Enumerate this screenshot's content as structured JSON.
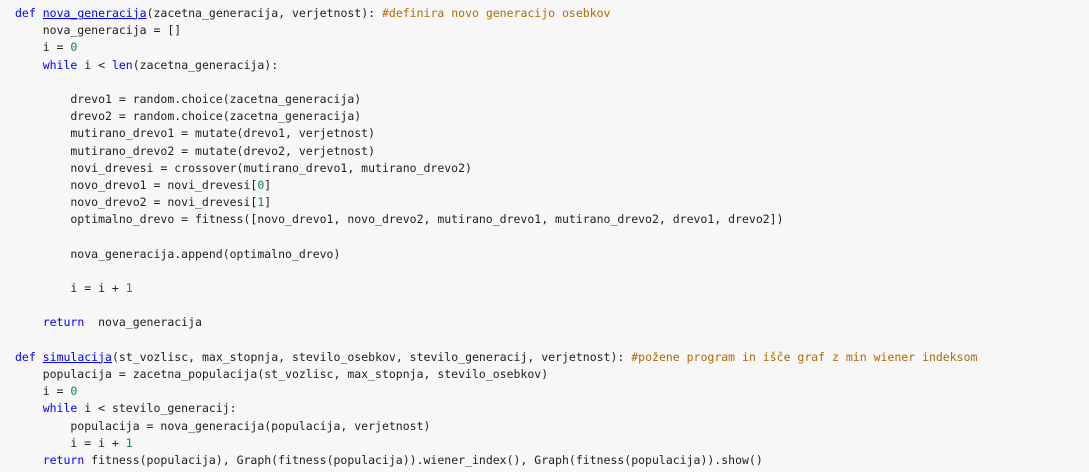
{
  "editor": {
    "background": "#f7f7f7",
    "colors": {
      "keyword": "#0000ff",
      "number": "#098658",
      "comment": "#af6b00",
      "text": "#212121"
    },
    "lines": [
      [
        {
          "t": "def",
          "c": "kw"
        },
        {
          "t": " ",
          "c": "pl"
        },
        {
          "t": "nova_generacija",
          "c": "fn"
        },
        {
          "t": "(zacetna_generacija, verjetnost): ",
          "c": "pl"
        },
        {
          "t": "#definira novo generacijo osebkov",
          "c": "cm"
        }
      ],
      [
        {
          "t": "    nova_generacija = []",
          "c": "pl"
        }
      ],
      [
        {
          "t": "    i = ",
          "c": "pl"
        },
        {
          "t": "0",
          "c": "num"
        }
      ],
      [
        {
          "t": "    ",
          "c": "pl"
        },
        {
          "t": "while",
          "c": "kw"
        },
        {
          "t": " i < ",
          "c": "pl"
        },
        {
          "t": "len",
          "c": "kw2"
        },
        {
          "t": "(zacetna_generacija):",
          "c": "pl"
        }
      ],
      [
        {
          "t": "",
          "c": "pl"
        }
      ],
      [
        {
          "t": "        drevo1 = random.choice(zacetna_generacija)",
          "c": "pl"
        }
      ],
      [
        {
          "t": "        drevo2 = random.choice(zacetna_generacija)",
          "c": "pl"
        }
      ],
      [
        {
          "t": "        mutirano_drevo1 = mutate(drevo1, verjetnost)",
          "c": "pl"
        }
      ],
      [
        {
          "t": "        mutirano_drevo2 = mutate(drevo2, verjetnost)",
          "c": "pl"
        }
      ],
      [
        {
          "t": "        novi_drevesi = crossover(mutirano_drevo1, mutirano_drevo2)",
          "c": "pl"
        }
      ],
      [
        {
          "t": "        novo_drevo1 = novi_drevesi[",
          "c": "pl"
        },
        {
          "t": "0",
          "c": "num"
        },
        {
          "t": "]",
          "c": "pl"
        }
      ],
      [
        {
          "t": "        novo_drevo2 = novi_drevesi[",
          "c": "pl"
        },
        {
          "t": "1",
          "c": "num"
        },
        {
          "t": "]",
          "c": "pl"
        }
      ],
      [
        {
          "t": "        optimalno_drevo = fitness([novo_drevo1, novo_drevo2, mutirano_drevo1, mutirano_drevo2, drevo1, drevo2])",
          "c": "pl"
        }
      ],
      [
        {
          "t": "",
          "c": "pl"
        }
      ],
      [
        {
          "t": "        nova_generacija.append(optimalno_drevo)",
          "c": "pl"
        }
      ],
      [
        {
          "t": "",
          "c": "pl"
        }
      ],
      [
        {
          "t": "        i = i + ",
          "c": "pl"
        },
        {
          "t": "1",
          "c": "num"
        }
      ],
      [
        {
          "t": "",
          "c": "pl"
        }
      ],
      [
        {
          "t": "    ",
          "c": "pl"
        },
        {
          "t": "return",
          "c": "kw"
        },
        {
          "t": "  nova_generacija",
          "c": "pl"
        }
      ],
      [
        {
          "t": "",
          "c": "pl"
        }
      ],
      [
        {
          "t": "def",
          "c": "kw"
        },
        {
          "t": " ",
          "c": "pl"
        },
        {
          "t": "simulacija",
          "c": "fn"
        },
        {
          "t": "(st_vozlisc, max_stopnja, stevilo_osebkov, stevilo_generacij, verjetnost): ",
          "c": "pl"
        },
        {
          "t": "#požene program in išče graf z min wiener indeksom",
          "c": "cm"
        }
      ],
      [
        {
          "t": "    populacija = zacetna_populacija(st_vozlisc, max_stopnja, stevilo_osebkov)",
          "c": "pl"
        }
      ],
      [
        {
          "t": "    i = ",
          "c": "pl"
        },
        {
          "t": "0",
          "c": "num"
        }
      ],
      [
        {
          "t": "    ",
          "c": "pl"
        },
        {
          "t": "while",
          "c": "kw"
        },
        {
          "t": " i < stevilo_generacij:",
          "c": "pl"
        }
      ],
      [
        {
          "t": "        populacija = nova_generacija(populacija, verjetnost)",
          "c": "pl"
        }
      ],
      [
        {
          "t": "        i = i + ",
          "c": "pl"
        },
        {
          "t": "1",
          "c": "num"
        }
      ],
      [
        {
          "t": "    ",
          "c": "pl"
        },
        {
          "t": "return",
          "c": "kw"
        },
        {
          "t": " fitness(populacija), Graph(fitness(populacija)).wiener_index(), Graph(fitness(populacija)).show()",
          "c": "pl"
        }
      ]
    ]
  }
}
